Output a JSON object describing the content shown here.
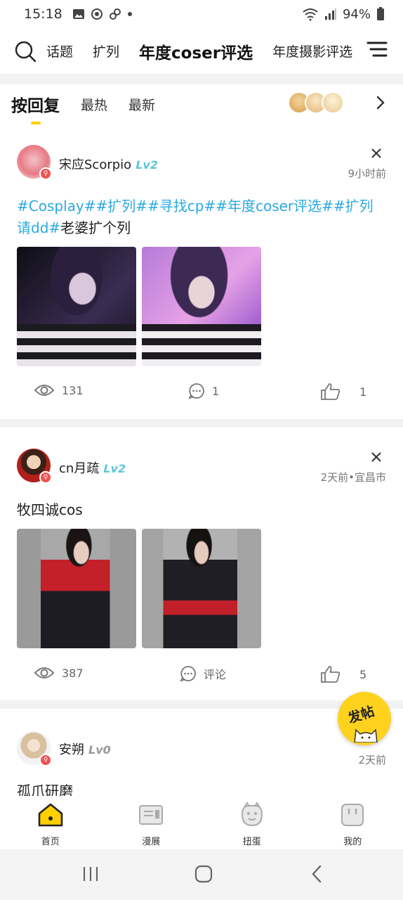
{
  "status_bar": {
    "time": "15:18",
    "battery": "94%"
  },
  "top_tabs": [
    {
      "label": "话题",
      "active": false
    },
    {
      "label": "扩列",
      "active": false
    },
    {
      "label": "年度coser评选",
      "active": true
    },
    {
      "label": "年度摄影评选",
      "active": false
    }
  ],
  "sort_tabs": [
    {
      "label": "按回复",
      "active": true
    },
    {
      "label": "最热",
      "active": false
    },
    {
      "label": "最新",
      "active": false
    }
  ],
  "posts": [
    {
      "username": "宋应Scorpio",
      "level": "Lv2",
      "time": "9小时前",
      "tags": "#Cosplay##扩列##寻找cp##年度coser评选##扩列请dd#",
      "text": "老婆扩个列",
      "views": "131",
      "comments": "1",
      "likes": "1"
    },
    {
      "username": "cn月疏",
      "level": "Lv2",
      "time": "2天前•宜昌市",
      "tags": "",
      "text": "牧四诚cos",
      "views": "387",
      "comments": "评论",
      "likes": "5"
    },
    {
      "username": "安朔",
      "level": "Lv0",
      "time": "2天前",
      "tags": "",
      "text": "孤爪研磨"
    }
  ],
  "fab": {
    "label": "发帖"
  },
  "bottom_nav": [
    {
      "label": "首页",
      "icon": "home-icon",
      "active": true
    },
    {
      "label": "漫展",
      "icon": "expo-icon",
      "active": false
    },
    {
      "label": "扭蛋",
      "icon": "gacha-icon",
      "active": false
    },
    {
      "label": "我的",
      "icon": "profile-icon",
      "active": false
    }
  ],
  "colors": {
    "accent": "#ffd000",
    "tag": "#2ba8e0",
    "level": "#5cc6d8",
    "level_zero": "#9a9a9a"
  }
}
